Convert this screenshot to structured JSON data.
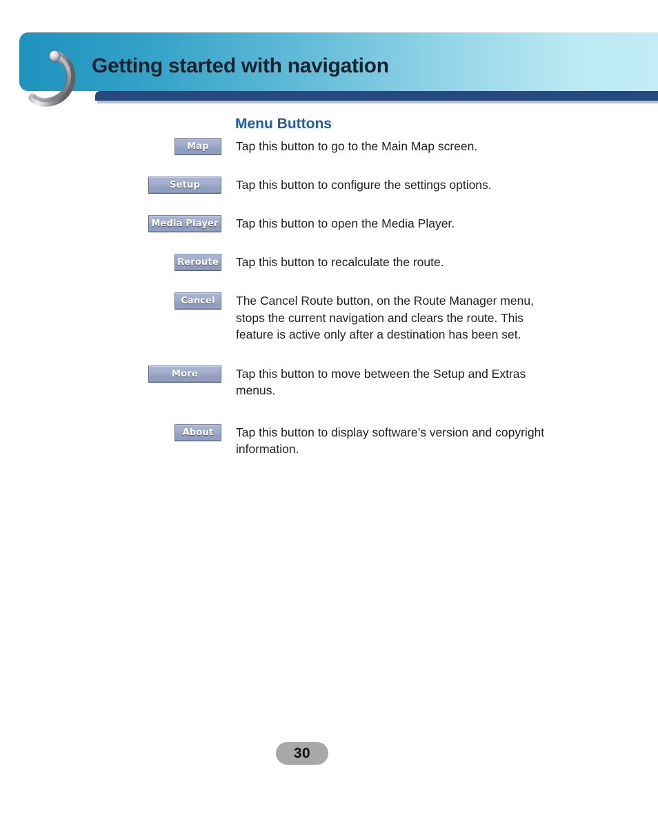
{
  "header": {
    "title": "Getting started with navigation",
    "band_gradient_from": "#1f93bd",
    "band_gradient_to": "#c2ecf6",
    "navbar_color": "#26497f",
    "title_color": "#16222e",
    "spiral_icon": "spiral-binding-hook-icon"
  },
  "section": {
    "title": "Menu Buttons",
    "title_color": "#1d5fb5"
  },
  "rows": [
    {
      "button_label": "Map",
      "button_width": "w-map",
      "description": "Tap this button to go to the Main Map screen."
    },
    {
      "button_label": "Setup",
      "button_width": "w-setup",
      "description": "Tap this button to configure the settings options."
    },
    {
      "button_label": "Media Player",
      "button_width": "w-media",
      "description": "Tap this button to open the Media Player."
    },
    {
      "button_label": "Reroute",
      "button_width": "w-reroute",
      "description": "Tap this button to recalculate the route."
    },
    {
      "button_label": "Cancel",
      "button_width": "w-cancel",
      "description": "The Cancel Route button, on the Route Manager menu, stops the current navigation and clears the route. This feature is active only after a destination has been set."
    },
    {
      "button_label": "More",
      "button_width": "w-more",
      "description": "Tap this button to move between the Setup and Extras menus."
    },
    {
      "button_label": "About",
      "button_width": "w-about",
      "description": "Tap this button to display software’s version and copyright information."
    }
  ],
  "footer": {
    "page_number": "30",
    "pill_color": "#a8a8a8"
  },
  "button_style": {
    "face_top": "#aab5d2",
    "face_bottom": "#93a0c1",
    "border": "#5d6685",
    "text_color": "#ffffff"
  }
}
